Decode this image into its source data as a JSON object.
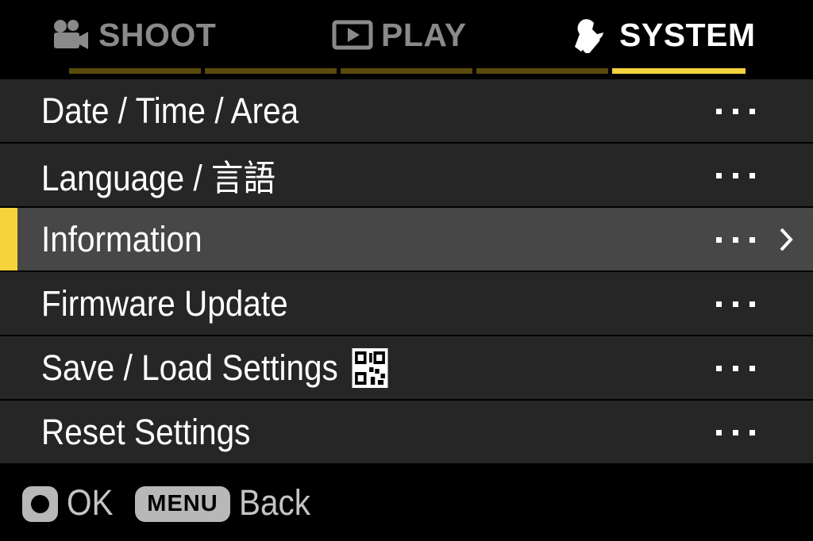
{
  "tabs": [
    {
      "label": "SHOOT",
      "icon": "movie-camera-icon",
      "active": false
    },
    {
      "label": "PLAY",
      "icon": "play-icon",
      "active": false
    },
    {
      "label": "SYSTEM",
      "icon": "wrench-icon",
      "active": true
    }
  ],
  "page_indicator": {
    "pages": 5,
    "current": 5
  },
  "menu": {
    "items": [
      {
        "label": "Date / Time / Area",
        "value": "•••"
      },
      {
        "label": "Language / 言語",
        "value": "•••"
      },
      {
        "label": "Information",
        "value": "•••",
        "selected": true
      },
      {
        "label": "Firmware Update",
        "value": "•••"
      },
      {
        "label": "Save / Load Settings",
        "value": "•••",
        "icon": "qr-code-icon"
      },
      {
        "label": "Reset Settings",
        "value": "•••"
      }
    ]
  },
  "footer": {
    "ok_label": "OK",
    "menu_key": "MENU",
    "back_label": "Back"
  },
  "colors": {
    "accent": "#f5d33a",
    "row_bg": "#262626",
    "row_selected_bg": "#474747",
    "inactive_tab": "#8a8a8a"
  }
}
